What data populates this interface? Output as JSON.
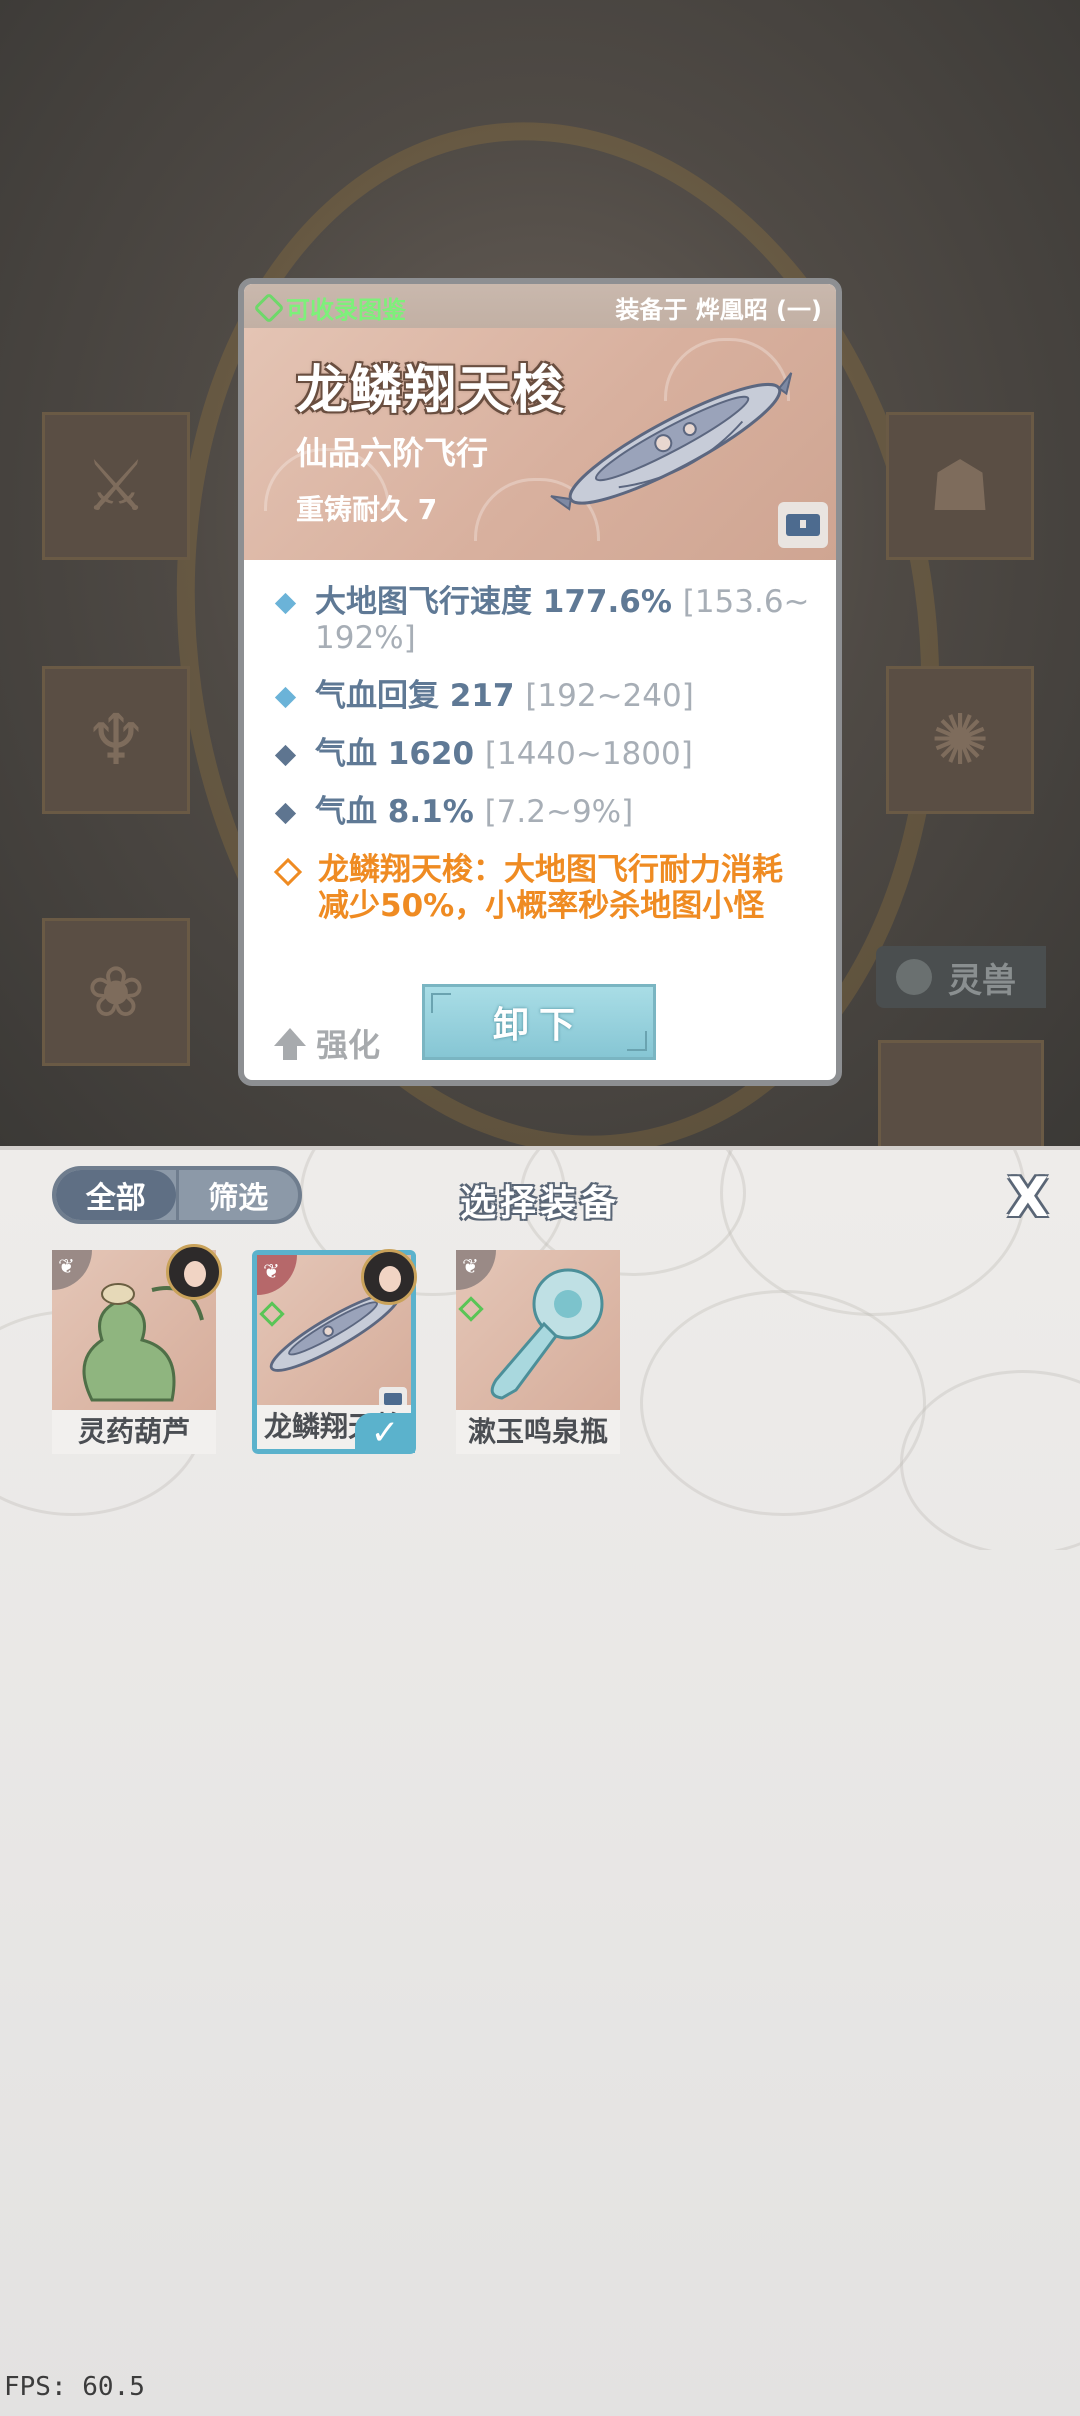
{
  "popup": {
    "collect_label": "可收录图鉴",
    "equipped_by": "装备于 烨凰昭 (一)",
    "item_name": "龙鳞翔天梭",
    "grade": "仙品六阶飞行",
    "recast": "重铸耐久 7",
    "stats": [
      {
        "text": "大地图飞行速度 177.6%",
        "range": "[153.6~192%]"
      },
      {
        "text": "气血回复 217",
        "range": "[192~240]"
      },
      {
        "text": "气血 1620",
        "range": "[1440~1800]"
      },
      {
        "text": "气血 8.1%",
        "range": "[7.2~9%]"
      }
    ],
    "special_effect": "龙鳞翔天梭：大地图飞行耐力消耗减少50%，小概率秒杀地图小怪",
    "enhance_label": "强化",
    "unequip_label": "卸下"
  },
  "background": {
    "pet_tab_label": "灵兽"
  },
  "panel": {
    "tabs": [
      {
        "label": "全部",
        "active": true
      },
      {
        "label": "筛选",
        "active": false
      }
    ],
    "title": "选择装备",
    "close_label": "X",
    "items": [
      {
        "name": "灵药葫芦",
        "selected": false
      },
      {
        "name": "龙鳞翔天梭",
        "selected": true
      },
      {
        "name": "漱玉鸣泉瓶",
        "selected": false
      }
    ]
  },
  "debug": {
    "fps": "FPS: 60.5"
  },
  "colors": {
    "accent": "#5bb2cc",
    "special": "#ef8b22",
    "stat": "#5f7995",
    "collect": "#7df07a"
  }
}
